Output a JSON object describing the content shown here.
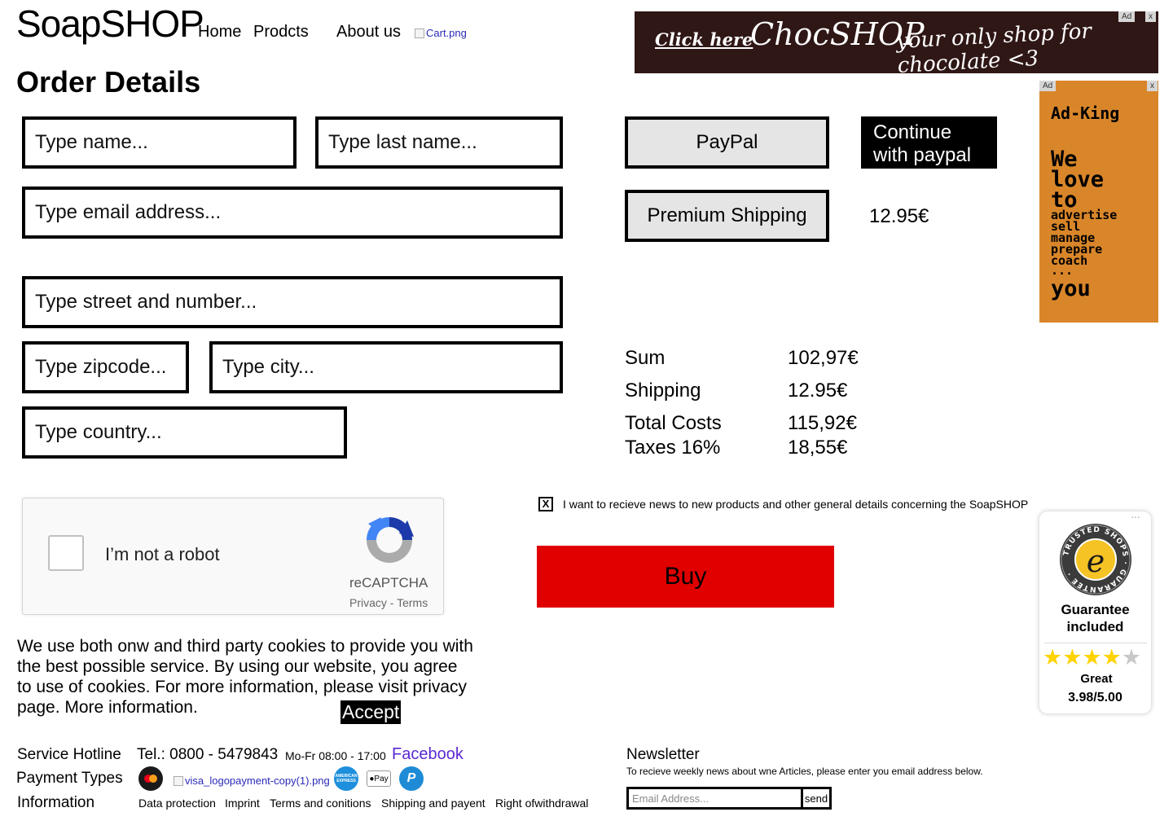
{
  "header": {
    "logo": "SoapSHOP",
    "nav": [
      "Home",
      "Prodcts",
      "About us"
    ],
    "cart_alt": "Cart.png"
  },
  "banner_ad": {
    "badge": "Ad",
    "close": "x",
    "click_text": "Click here",
    "brand": "ChocSHOP",
    "tagline": "your only shop for chocolate <3",
    "bg_color": "#2f1716"
  },
  "page_title": "Order Details",
  "form": {
    "first_name": "Type name...",
    "last_name": "Type last name...",
    "email": "Type email address...",
    "street": "Type street and number...",
    "zipcode": "Type zipcode...",
    "city": "Type city...",
    "country": "Type country..."
  },
  "payment": {
    "paypal_label": "PayPal",
    "continue_paypal": "Continue with paypal",
    "premium_shipping": "Premium Shipping",
    "premium_price": "12.95€"
  },
  "side_ad": {
    "badge": "Ad",
    "close": "x",
    "title": "Ad-King",
    "line1": "We",
    "line2": "love",
    "line3": "to",
    "verbs": [
      "advertise",
      "sell",
      "manage",
      "prepare",
      "coach"
    ],
    "ellipsis": "...",
    "last": "you",
    "bg_color": "#d9862a"
  },
  "summary": {
    "rows": [
      {
        "label": "Sum",
        "value": "102,97€"
      },
      {
        "label": "Shipping",
        "value": "12.95€"
      },
      {
        "label": "Total Costs",
        "value": "115,92€"
      },
      {
        "label": "Taxes 16%",
        "value": "18,55€"
      }
    ]
  },
  "captcha": {
    "label": "I’m not a robot",
    "brand": "reCAPTCHA",
    "links": "Privacy - Terms"
  },
  "newsletter_opt": {
    "checked_mark": "X",
    "text": "I want to recieve news to new products and other general details concerning the SoapSHOP"
  },
  "buy_label": "Buy",
  "buy_color": "#e00000",
  "trust": {
    "ring_text": "TRUSTED SHOPS GUARANTEE",
    "letter": "e",
    "line1": "Guarantee",
    "line2": "included",
    "rating_word": "Great",
    "score": "3.98/5.00",
    "stars_filled": 4,
    "stars_total": 5,
    "more": "···"
  },
  "cookie": {
    "text": "We use both onw and third party cookies to provide you with the best possible service. By using our website, you agree to use of cookies. For more information, please visit privacy page.  More information.",
    "accept": "Accept"
  },
  "footer": {
    "hotline_label": "Service Hotline",
    "phone": "Tel.: 0800 - 5479843",
    "hours": "Mo-Fr 08:00 - 17:00",
    "facebook": "Facebook",
    "payment_label": "Payment Types",
    "visa_alt": "visa_logopayment-copy(1).png",
    "amex_text": "AMERICAN EXPRESS",
    "applepay_text": "Pay",
    "info_label": "Information",
    "links": [
      "Data protection",
      "Imprint",
      "Terms and conitions",
      "Shipping and payent",
      "Right ofwithdrawal"
    ]
  },
  "newsletter": {
    "title": "Newsletter",
    "desc": "To recieve weekly news about wne Articles, please enter you email address below.",
    "placeholder": "Email Address...",
    "send": "send"
  }
}
